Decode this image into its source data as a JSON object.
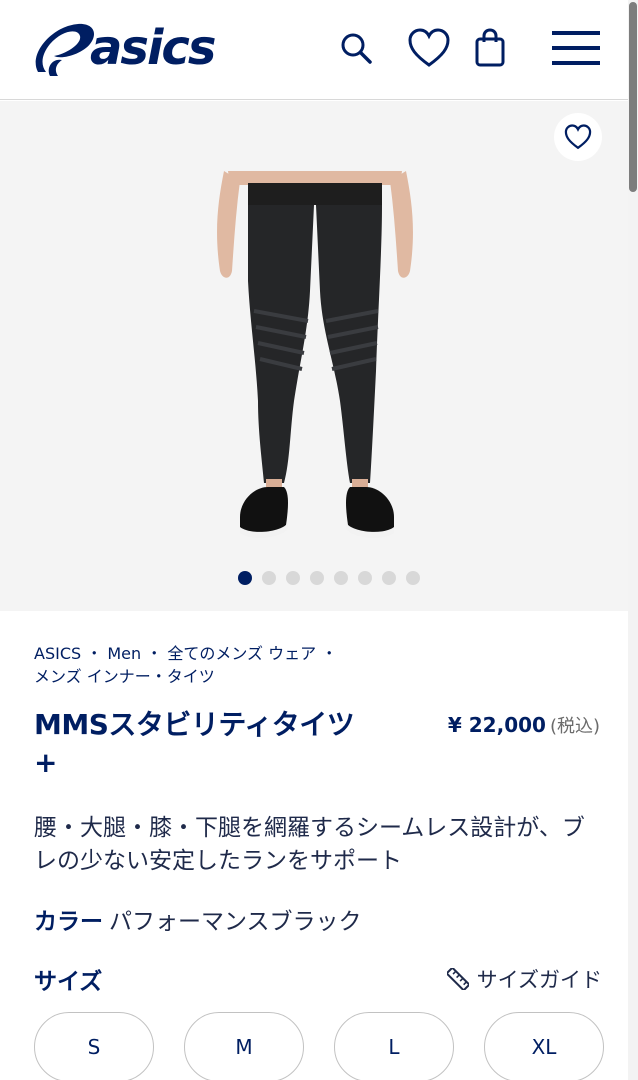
{
  "brand": {
    "name": "asics",
    "color": "#001e62"
  },
  "header": {
    "icons": [
      "search-icon",
      "heart-icon",
      "shopping-bag-icon",
      "menu-icon"
    ]
  },
  "gallery": {
    "image_alt": "product-image",
    "total_images": 8,
    "active_index": 1
  },
  "breadcrumb": {
    "items": [
      "ASICS",
      "Men",
      "全てのメンズ ウェア",
      "メンズ インナー・タイツ"
    ],
    "separator": "・"
  },
  "product": {
    "title": "MMSスタビリティタイツ+",
    "price": "¥ 22,000",
    "tax_note": "(税込)",
    "description": "腰・大腿・膝・下腿を網羅するシームレス設計が、ブレの少ない安定したランをサポート",
    "color_label": "カラー",
    "color_value": "パフォーマンスブラック"
  },
  "sizes": {
    "label": "サイズ",
    "guide_label": "サイズガイド",
    "options": [
      "S",
      "M",
      "L",
      "XL"
    ]
  }
}
